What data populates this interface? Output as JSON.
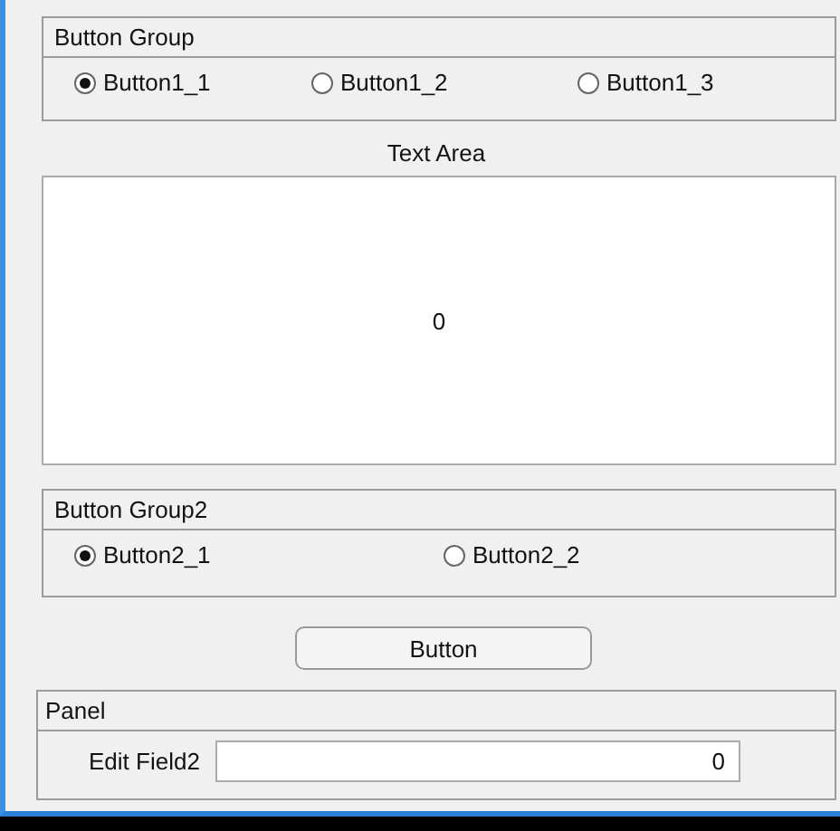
{
  "button_group_1": {
    "title": "Button Group",
    "options": [
      {
        "label": "Button1_1",
        "selected": true
      },
      {
        "label": "Button1_2",
        "selected": false
      },
      {
        "label": "Button1_3",
        "selected": false
      }
    ]
  },
  "text_area": {
    "label": "Text Area",
    "value": "0"
  },
  "button_group_2": {
    "title": "Button Group2",
    "options": [
      {
        "label": "Button2_1",
        "selected": true
      },
      {
        "label": "Button2_2",
        "selected": false
      }
    ]
  },
  "button": {
    "label": "Button"
  },
  "panel": {
    "title": "Panel",
    "field_label": "Edit Field2",
    "field_value": "0"
  }
}
